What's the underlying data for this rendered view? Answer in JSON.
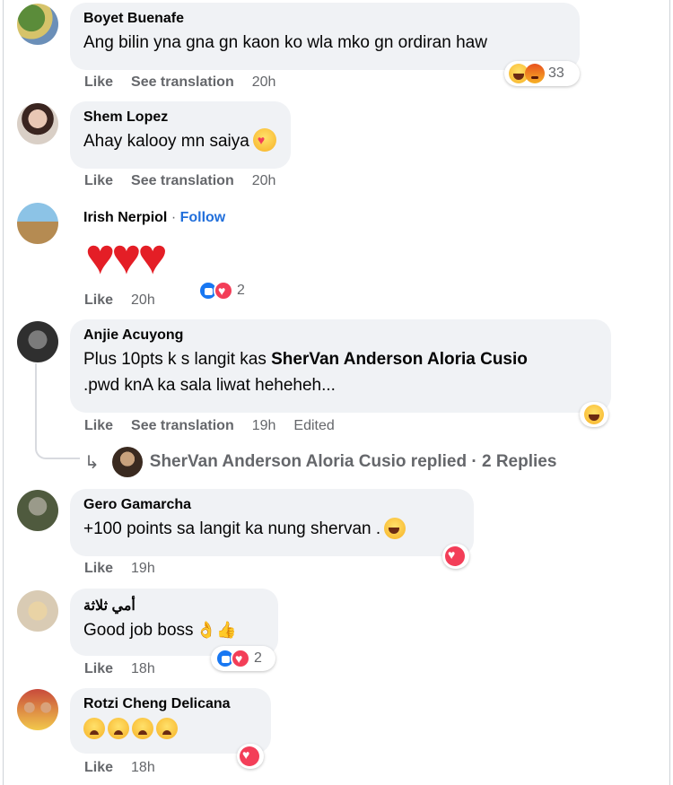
{
  "comments": [
    {
      "author": "Boyet Buenafe",
      "text": "Ang bilin yna gna gn kaon ko wla mko gn ordiran haw",
      "like": "Like",
      "translate": "See translation",
      "time": "20h",
      "reactions": [
        "laugh-icon",
        "angry-icon"
      ],
      "reaction_count": "33"
    },
    {
      "author": "Shem Lopez",
      "text": "Ahay kalooy mn saiya",
      "like": "Like",
      "translate": "See translation",
      "time": "20h",
      "inline_emoji": "care-emoji"
    },
    {
      "author": "Irish Nerpiol",
      "separator": "·",
      "follow": "Follow",
      "like": "Like",
      "time": "20h",
      "body_emoji": [
        "heart",
        "heart",
        "heart"
      ],
      "reactions": [
        "like-icon",
        "love-icon"
      ],
      "reaction_count": "2"
    },
    {
      "author": "Anjie Acuyong",
      "text_before": "Plus 10pts k s langit kas ",
      "mention": "SherVan Anderson Aloria Cusio",
      "text_after": ".pwd knA ka sala liwat heheheh...",
      "like": "Like",
      "translate": "See translation",
      "time": "19h",
      "edited": "Edited",
      "reactions": [
        "laugh-icon"
      ]
    },
    {
      "author": "Gero Gamarcha",
      "text": "+100 points sa langit ka nung shervan .",
      "like": "Like",
      "time": "19h",
      "reactions": [
        "love-icon"
      ]
    },
    {
      "author": "أمي ثلاثة",
      "text": "Good job boss",
      "like": "Like",
      "time": "18h",
      "reactions": [
        "like-icon",
        "love-icon"
      ],
      "reaction_count": "2"
    },
    {
      "author": "Rotzi Cheng Delicana",
      "like": "Like",
      "time": "18h",
      "body_emoji": [
        "crying",
        "crying",
        "crying",
        "crying"
      ],
      "reactions": [
        "love-icon"
      ]
    }
  ],
  "reply": {
    "text": "SherVan Anderson Aloria Cusio replied · 2 Replies"
  }
}
